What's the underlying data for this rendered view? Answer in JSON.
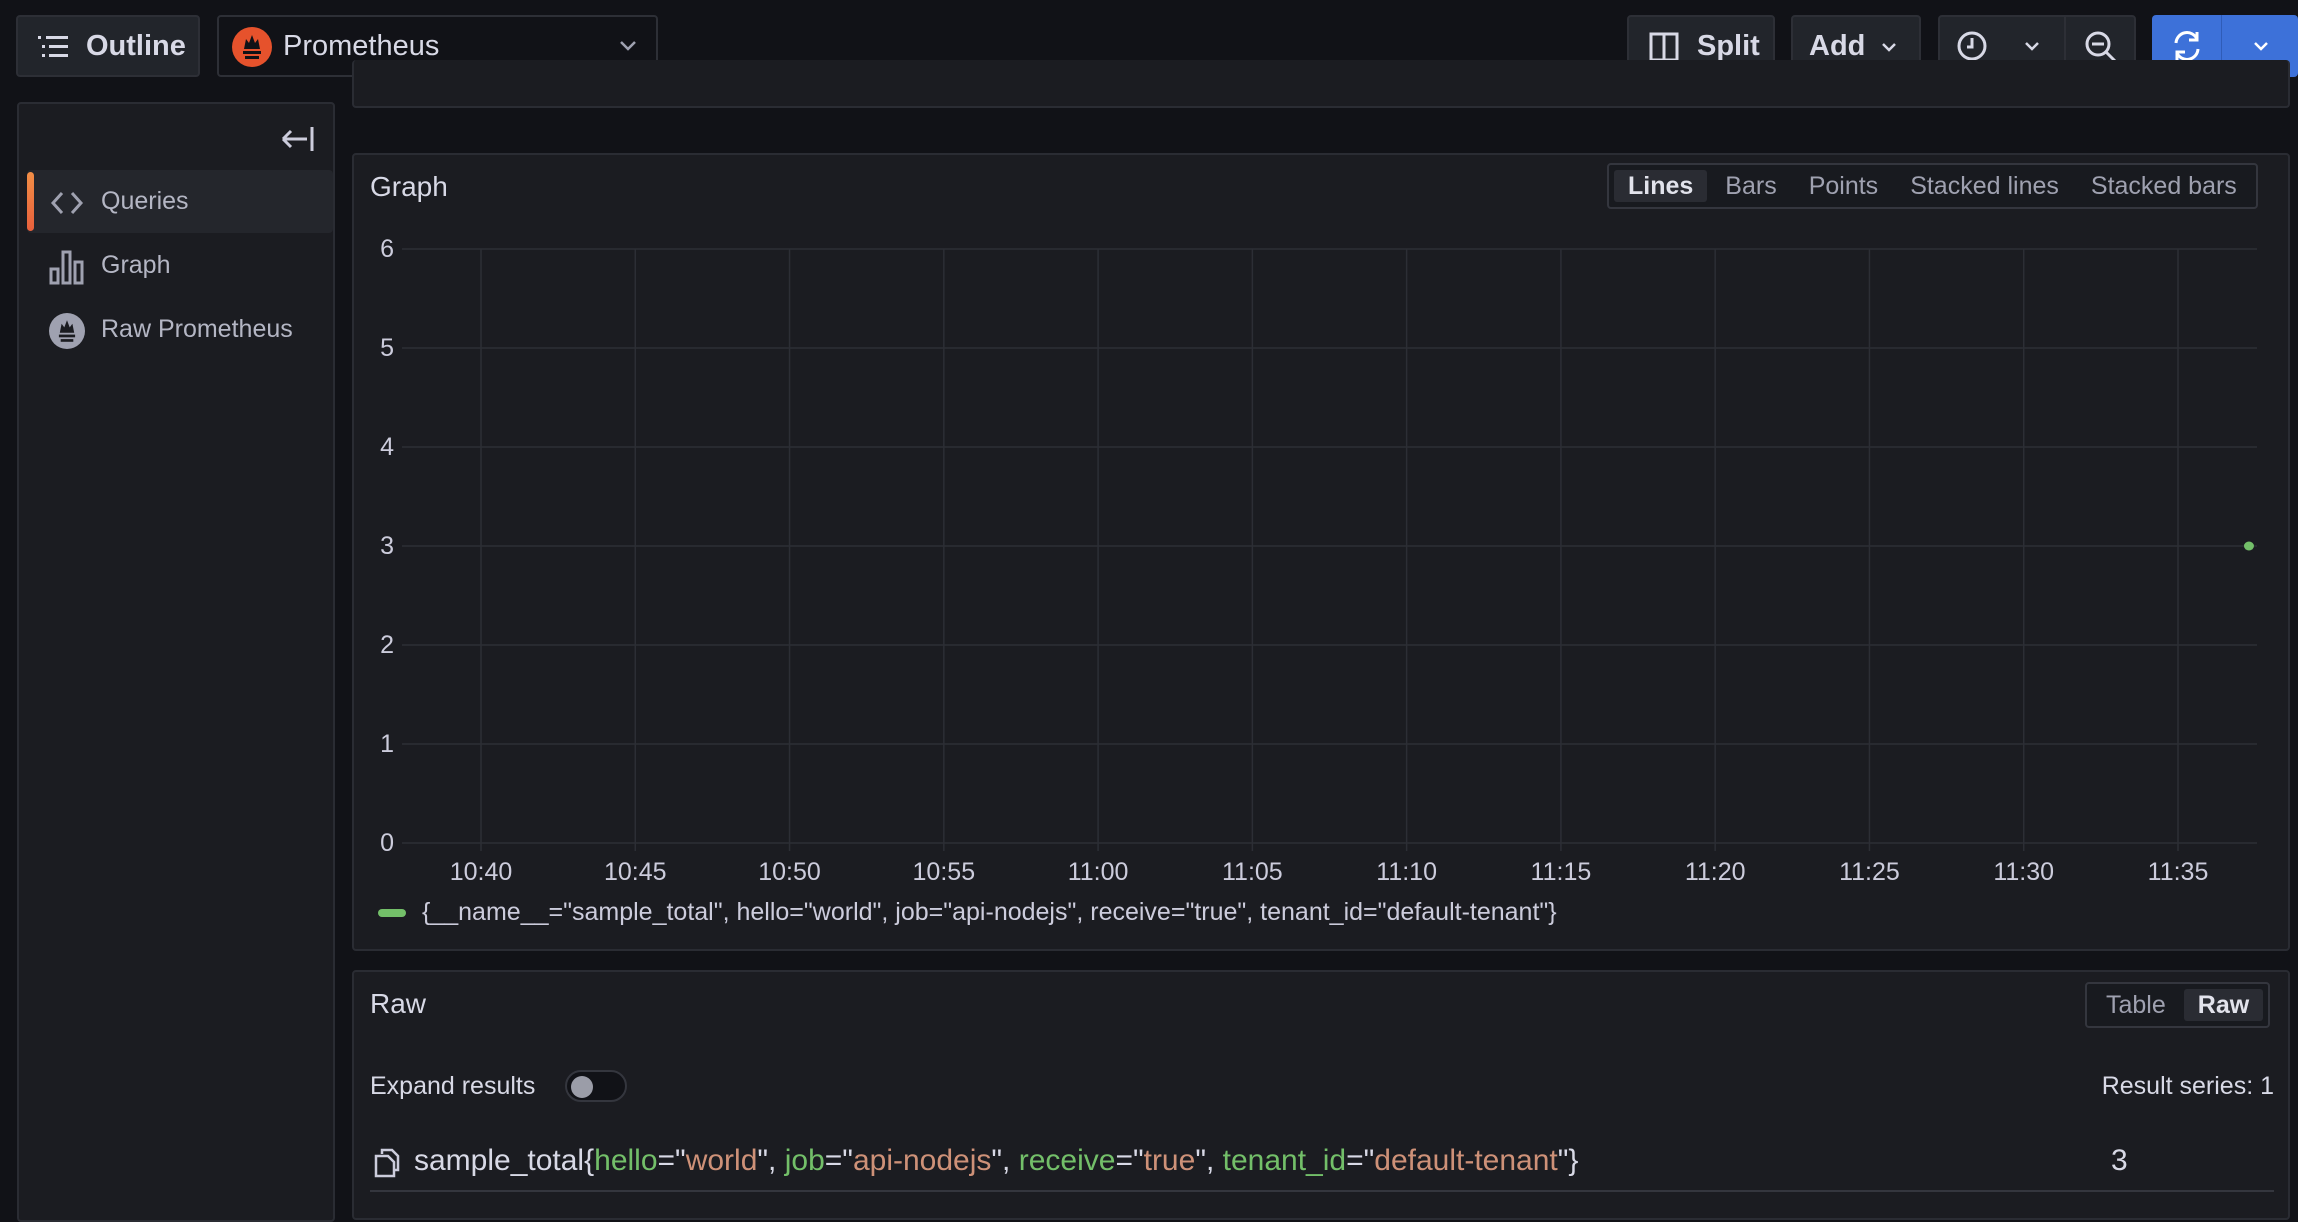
{
  "toolbar": {
    "outline_label": "Outline",
    "datasource": {
      "name": "Prometheus",
      "icon": "prometheus-logo-icon"
    },
    "split_label": "Split",
    "add_label": "Add",
    "time_icon": "clock-icon",
    "zoom_out_icon": "zoom-out-icon",
    "refresh_icon": "refresh-icon",
    "refresh_color": "#3d71d9"
  },
  "sidebar": {
    "collapse_icon": "collapse-left-icon",
    "items": [
      {
        "label": "Queries",
        "icon": "code-icon",
        "active": true
      },
      {
        "label": "Graph",
        "icon": "bar-chart-icon",
        "active": false
      },
      {
        "label": "Raw Prometheus",
        "icon": "prometheus-logo-icon",
        "active": false
      }
    ],
    "active_accent": "#f28e46"
  },
  "graph_panel": {
    "title": "Graph",
    "view_tabs": [
      {
        "label": "Lines",
        "active": true
      },
      {
        "label": "Bars",
        "active": false
      },
      {
        "label": "Points",
        "active": false
      },
      {
        "label": "Stacked lines",
        "active": false
      },
      {
        "label": "Stacked bars",
        "active": false
      }
    ],
    "legend_label": "{__name__=\"sample_total\", hello=\"world\", job=\"api-nodejs\", receive=\"true\", tenant_id=\"default-tenant\"}"
  },
  "chart_data": {
    "type": "line",
    "title": "Graph",
    "xlabel": "",
    "ylabel": "",
    "x_ticks": [
      "10:40",
      "10:45",
      "10:50",
      "10:55",
      "11:00",
      "11:05",
      "11:10",
      "11:15",
      "11:20",
      "11:25",
      "11:30",
      "11:35"
    ],
    "y_ticks": [
      0,
      1,
      2,
      3,
      4,
      5,
      6
    ],
    "ylim": [
      0,
      6
    ],
    "xlim_minutes_after_10_40": [
      -4.9,
      57.6
    ],
    "grid": true,
    "legend_position": "bottom-left",
    "series": [
      {
        "name": "{__name__=\"sample_total\", hello=\"world\", job=\"api-nodejs\", receive=\"true\", tenant_id=\"default-tenant\"}",
        "color": "#73bf69",
        "points": [
          {
            "x": "11:37",
            "minutes_after_10_40": 57.3,
            "y": 3
          }
        ]
      }
    ]
  },
  "raw_panel": {
    "title": "Raw",
    "view_tabs": [
      {
        "label": "Table",
        "active": false
      },
      {
        "label": "Raw",
        "active": true
      }
    ],
    "expand_label": "Expand results",
    "expand_on": false,
    "result_series_label": "Result series: 1",
    "result": {
      "copy_icon": "copy-icon",
      "metric": "sample_total",
      "labels": [
        {
          "key": "hello",
          "value": "world"
        },
        {
          "key": "job",
          "value": "api-nodejs"
        },
        {
          "key": "receive",
          "value": "true"
        },
        {
          "key": "tenant_id",
          "value": "default-tenant"
        }
      ],
      "value": "3"
    }
  }
}
